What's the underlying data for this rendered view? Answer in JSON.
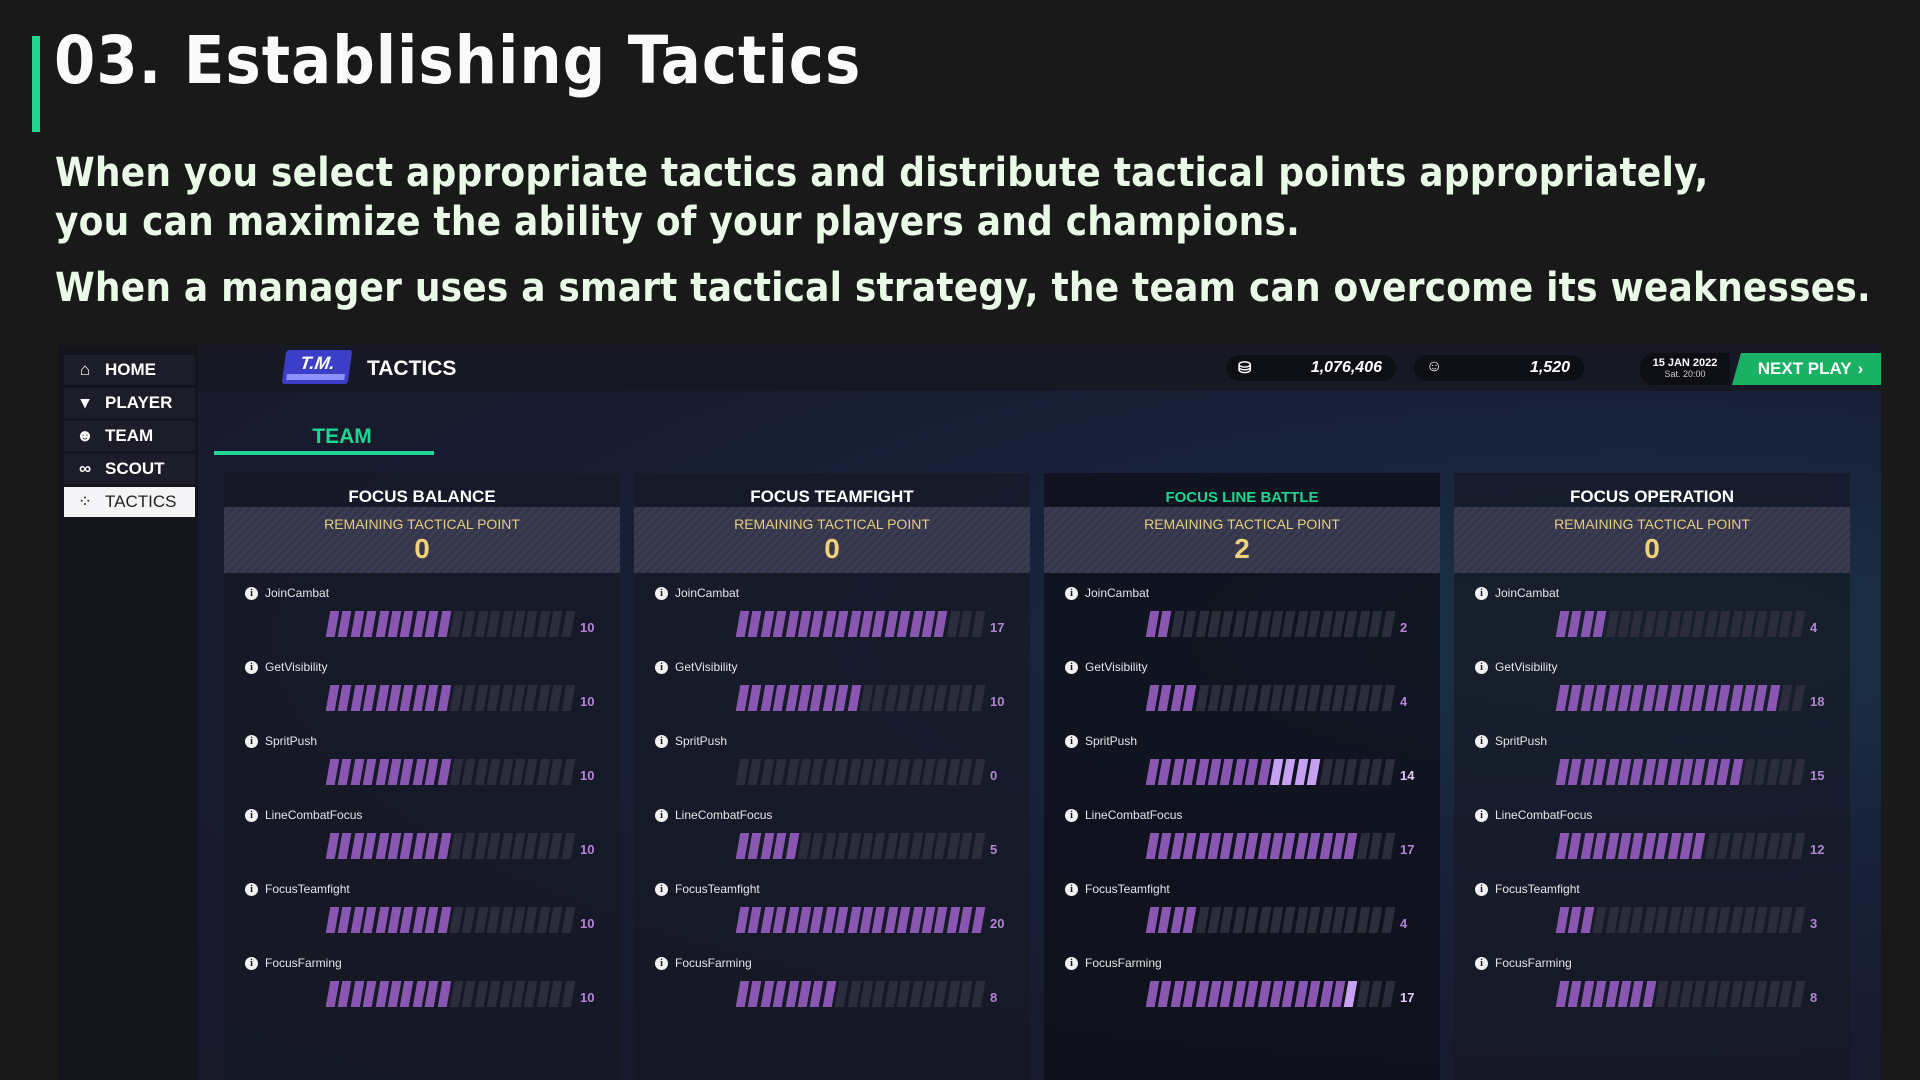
{
  "slide": {
    "title": "03. Establishing Tactics",
    "lines": [
      "When you select appropriate tactics and distribute tactical points appropriately,",
      "you can maximize the ability of your players and champions.",
      "When a manager uses a smart tactical strategy, the team can overcome its weaknesses."
    ]
  },
  "sidebar": {
    "items": [
      {
        "label": "HOME",
        "icon": "home-icon"
      },
      {
        "label": "PLAYER",
        "icon": "shirt-icon"
      },
      {
        "label": "TEAM",
        "icon": "team-icon"
      },
      {
        "label": "SCOUT",
        "icon": "binoculars-icon"
      },
      {
        "label": "TACTICS",
        "icon": "tactics-icon",
        "active": true
      }
    ]
  },
  "header": {
    "logo": "T.M.",
    "title": "TACTICS",
    "currency": "1,076,406",
    "fans": "1,520",
    "date": "15 JAN 2022",
    "time": "Sat. 20:00",
    "next_play": "NEXT PLAY"
  },
  "tab": "TEAM",
  "remaining_label": "REMAINING TACTICAL POINT",
  "max_segments": 20,
  "columns": [
    {
      "title": "FOCUS BALANCE",
      "remaining": "0",
      "selected": false,
      "stats": [
        {
          "name": "JoinCambat",
          "value": 10
        },
        {
          "name": "GetVisibility",
          "value": 10
        },
        {
          "name": "SpritPush",
          "value": 10
        },
        {
          "name": "LineCombatFocus",
          "value": 10
        },
        {
          "name": "FocusTeamfight",
          "value": 10
        },
        {
          "name": "FocusFarming",
          "value": 10
        }
      ]
    },
    {
      "title": "FOCUS TEAMFIGHT",
      "remaining": "0",
      "selected": false,
      "stats": [
        {
          "name": "JoinCambat",
          "value": 17
        },
        {
          "name": "GetVisibility",
          "value": 10
        },
        {
          "name": "SpritPush",
          "value": 0
        },
        {
          "name": "LineCombatFocus",
          "value": 5
        },
        {
          "name": "FocusTeamfight",
          "value": 20
        },
        {
          "name": "FocusFarming",
          "value": 8
        }
      ]
    },
    {
      "title": "FOCUS LINE BATTLE",
      "remaining": "2",
      "selected": true,
      "stats": [
        {
          "name": "JoinCambat",
          "value": 2
        },
        {
          "name": "GetVisibility",
          "value": 4
        },
        {
          "name": "SpritPush",
          "value": 14,
          "highlight_from": 10
        },
        {
          "name": "LineCombatFocus",
          "value": 17
        },
        {
          "name": "FocusTeamfight",
          "value": 4
        },
        {
          "name": "FocusFarming",
          "value": 17,
          "highlight_from": 16
        }
      ]
    },
    {
      "title": "FOCUS OPERATION",
      "remaining": "0",
      "selected": false,
      "stats": [
        {
          "name": "JoinCambat",
          "value": 4
        },
        {
          "name": "GetVisibility",
          "value": 18
        },
        {
          "name": "SpritPush",
          "value": 15
        },
        {
          "name": "LineCombatFocus",
          "value": 12
        },
        {
          "name": "FocusTeamfight",
          "value": 3
        },
        {
          "name": "FocusFarming",
          "value": 8
        }
      ]
    }
  ],
  "colors": {
    "accent": "#1ed690",
    "bar_on": "#8957b1",
    "bar_highlight": "#c8a2f2",
    "bar_off": "#2c2d3c",
    "point_gold": "#f0d27a"
  }
}
